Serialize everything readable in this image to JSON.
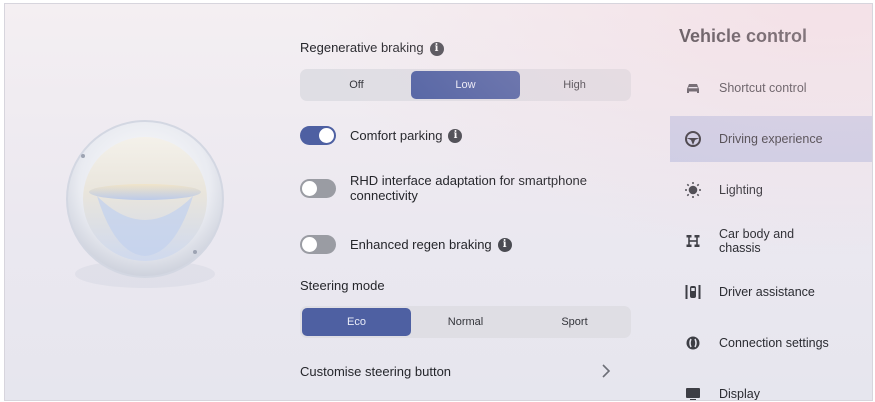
{
  "regen_braking": {
    "title": "Regenerative braking",
    "options": [
      "Off",
      "Low",
      "High"
    ],
    "selected": "Low"
  },
  "toggles": {
    "comfort_parking": {
      "label": "Comfort parking",
      "on": true
    },
    "rhd_adaptation": {
      "label": "RHD interface adaptation for smartphone connectivity",
      "on": false
    },
    "enhanced_regen": {
      "label": "Enhanced regen braking",
      "on": false
    }
  },
  "steering_mode": {
    "title": "Steering mode",
    "options": [
      "Eco",
      "Normal",
      "Sport"
    ],
    "selected": "Eco"
  },
  "customise_steering": {
    "label": "Customise steering button"
  },
  "menu": {
    "title": "Vehicle control",
    "items": [
      {
        "label": "Shortcut control",
        "icon": "car-icon"
      },
      {
        "label": "Driving experience",
        "icon": "steering-wheel-icon",
        "active": true
      },
      {
        "label": "Lighting",
        "icon": "light-icon"
      },
      {
        "label": "Car body and chassis",
        "icon": "chassis-icon"
      },
      {
        "label": "Driver assistance",
        "icon": "driver-assistance-icon"
      },
      {
        "label": "Connection settings",
        "icon": "connection-icon"
      },
      {
        "label": "Display",
        "icon": "display-icon"
      }
    ]
  },
  "colors": {
    "accent": "#4e60a2",
    "active_menu_bg": "#c9cde6",
    "toggle_off": "#9a9ca3"
  }
}
